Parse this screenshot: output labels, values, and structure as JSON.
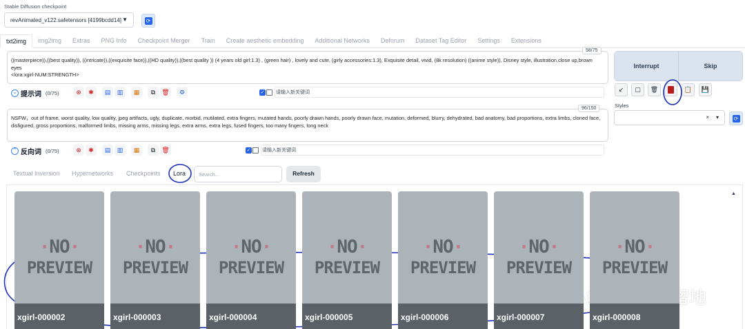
{
  "checkpoint": {
    "label": "Stable Diffusion checkpoint",
    "value": "revAnimated_v122.safetensors [4199bcdd14]"
  },
  "tabs": [
    "txt2img",
    "img2img",
    "Extras",
    "PNG Info",
    "Checkpoint Merger",
    "Train",
    "Create aesthetic embedding",
    "Additional Networks",
    "Deforum",
    "Dataset Tag Editor",
    "Settings",
    "Extensions"
  ],
  "active_tab": "txt2img",
  "prompt": {
    "text": "((masterpiece)),((best quality)), ((intricate)),((exquisite face)),((HD quality)),((best quality ))   (4 years old  girl:1.3)  , (green hair) , lovely and cute, (girly accessories:1.3), Exquisite detail, vivid,   (8k resolution)  ((anime style)), Disney style, illustration,close up,brown eyes",
    "lora_line": "<lora:xgirl-NUM:STRENGTH>",
    "counter": "58/75",
    "label": "提示词",
    "count": "(0/75)",
    "keyword_placeholder": "请输入新关键词"
  },
  "negative": {
    "text": "NSFW，out of frame, worst quality, low quality, jpeg artifacts, ugly, duplicate, morbid, mutilated, extra fingers, mutated hands, poorly drawn hands, poorly drawn face, mutation, deformed, blurry, dehydrated, bad anatomy, bad proportions, extra limbs, cloned face, disfigured, gross proportions, malformed limbs, missing arms, missing legs, extra arms, extra legs, fused fingers, too many fingers, long neck",
    "counter": "96/150",
    "label": "反向词",
    "count": "(0/75)",
    "keyword_placeholder": "请输入新关键词"
  },
  "generate": {
    "interrupt": "Interrupt",
    "skip": "Skip"
  },
  "styles": {
    "label": "Styles",
    "clear": "×",
    "chevron": "▾"
  },
  "networks": {
    "tabs": [
      "Textual Inversion",
      "Hypernetworks",
      "Checkpoints",
      "Lora"
    ],
    "active": "Lora",
    "search_placeholder": "Search...",
    "refresh": "Refresh",
    "preview_line1": "NO",
    "preview_line2": "PREVIEW",
    "cards": [
      "xgirl-000002",
      "xgirl-000003",
      "xgirl-000004",
      "xgirl-000005",
      "xgirl-000006",
      "xgirl-000007",
      "xgirl-000008"
    ]
  },
  "watermark": "小鱼姐姐的自留地",
  "colors": {
    "accent": "#2563eb",
    "annotation": "#1a2fb8",
    "card": "#adb4b9",
    "caption": "#5b6166"
  }
}
